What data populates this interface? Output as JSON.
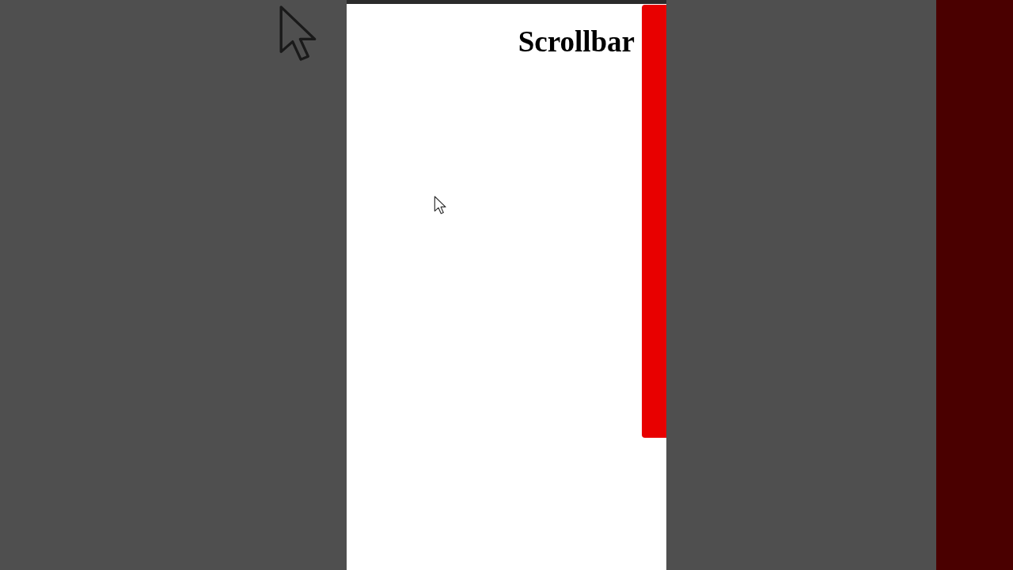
{
  "page": {
    "heading": "Scrollbar"
  }
}
